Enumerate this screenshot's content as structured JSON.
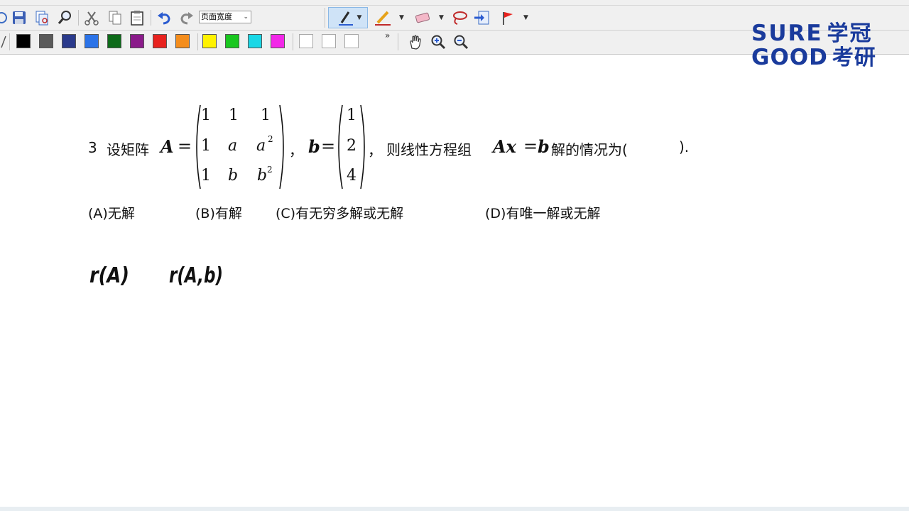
{
  "toolbar": {
    "zoom_value": "页面宽度",
    "colors": [
      "#000000",
      "#5a5a5a",
      "#2a3a8c",
      "#2b73e8",
      "#0e6b1a",
      "#8a1a8a",
      "#e8221e",
      "#f48d1c",
      "#fff200",
      "#19c71f",
      "#19d7e6",
      "#f227e8"
    ],
    "more_glyph": "»"
  },
  "logo": {
    "line1_en": "SURE",
    "line1_cn": "学冠",
    "line2_en": "GOOD",
    "line2_cn": "考研",
    "color": "#1a3b9c"
  },
  "question": {
    "number": "3",
    "prefix": "设矩阵",
    "A_label": "A",
    "matrix_A": [
      [
        "1",
        "1",
        "1"
      ],
      [
        "1",
        "a",
        "a"
      ],
      [
        "1",
        "b",
        "b"
      ]
    ],
    "vector_b_label": "b",
    "vector_b": [
      "1",
      "2",
      "4"
    ],
    "comma": "，",
    "middle_text": "则线性方程组",
    "equation_left": "Ax",
    "equation_right": "b",
    "suffix": "解的情况为(",
    "close": ").",
    "superscript": "2",
    "options": {
      "a": "(A)无解",
      "b": "(B)有解",
      "c": "(C)有无穷多解或无解",
      "d": "(D)有唯一解或无解"
    }
  },
  "handwriting": {
    "note1": "r(A)",
    "note2": "r(A,b)"
  }
}
